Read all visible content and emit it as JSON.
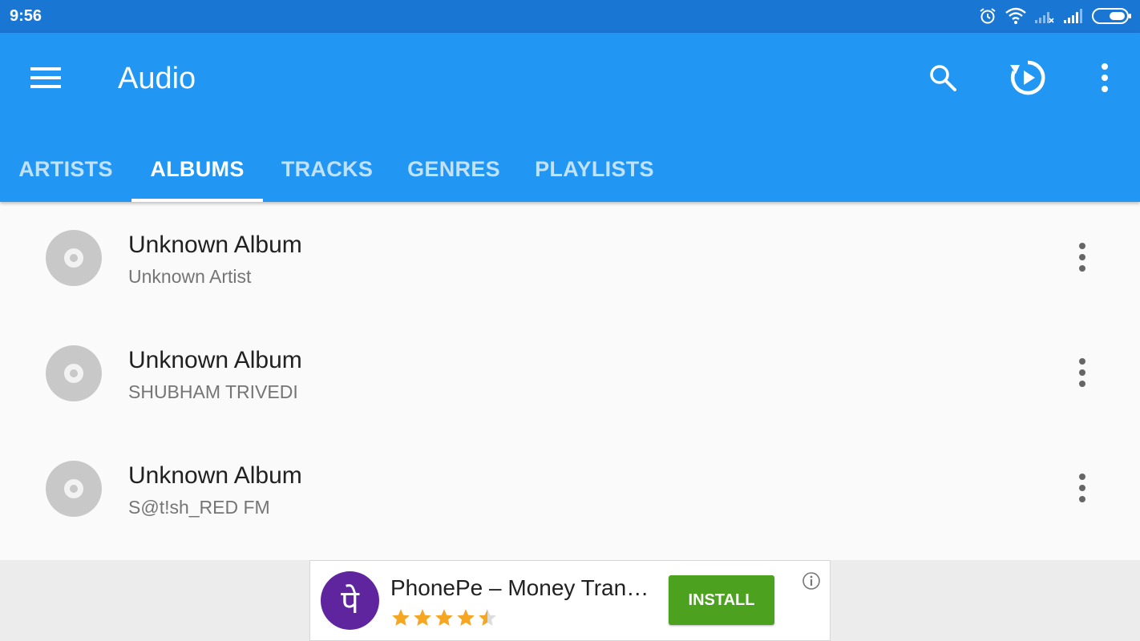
{
  "status_bar": {
    "time": "9:56",
    "icons": [
      "alarm-icon",
      "wifi-icon",
      "signal-no-service-icon",
      "signal-icon",
      "battery-icon"
    ]
  },
  "app_bar": {
    "title": "Audio",
    "menu_icon": "hamburger-menu-icon",
    "actions": [
      "search-icon",
      "resume-playback-icon",
      "more-vert-icon"
    ],
    "color": "#2196f3"
  },
  "tabs": [
    {
      "label": "ARTISTS",
      "active": false
    },
    {
      "label": "ALBUMS",
      "active": true
    },
    {
      "label": "TRACKS",
      "active": false
    },
    {
      "label": "GENRES",
      "active": false
    },
    {
      "label": "PLAYLISTS",
      "active": false
    }
  ],
  "albums": [
    {
      "title": "Unknown Album",
      "artist": "Unknown Artist"
    },
    {
      "title": "Unknown Album",
      "artist": "SHUBHAM TRIVEDI"
    },
    {
      "title": "Unknown Album",
      "artist": "S@t!sh_RED FM"
    }
  ],
  "ad": {
    "logo_text": "पे",
    "title": "PhonePe – Money Tran…",
    "rating": 4.5,
    "install_label": "INSTALL",
    "install_color": "#4ca21f",
    "logo_color": "#5f259f"
  }
}
